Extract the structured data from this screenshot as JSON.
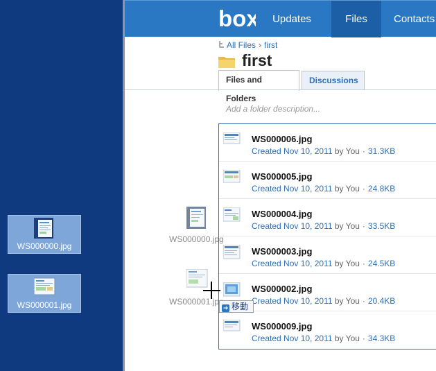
{
  "desktop": {
    "icons": [
      {
        "name": "WS000000.jpg"
      },
      {
        "name": "WS000001.jpg"
      }
    ]
  },
  "topbar": {
    "logo_text": "box",
    "nav": [
      {
        "label": "Updates"
      },
      {
        "label": "Files"
      },
      {
        "label": "Contacts"
      }
    ]
  },
  "breadcrumb": {
    "root": "All Files",
    "sep": "›",
    "current": "first"
  },
  "folder": {
    "title": "first",
    "description_placeholder": "Add a folder description..."
  },
  "tabs": [
    {
      "label": "Files and Folders"
    },
    {
      "label": "Discussions"
    }
  ],
  "files": [
    {
      "name": "WS000006.jpg",
      "created": "Created Nov 10, 2011",
      "by": "by You",
      "size": "31.3KB"
    },
    {
      "name": "WS000005.jpg",
      "created": "Created Nov 10, 2011",
      "by": "by You",
      "size": "24.8KB"
    },
    {
      "name": "WS000004.jpg",
      "created": "Created Nov 10, 2011",
      "by": "by You",
      "size": "33.5KB"
    },
    {
      "name": "WS000003.jpg",
      "created": "Created Nov 10, 2011",
      "by": "by You",
      "size": "24.5KB"
    },
    {
      "name": "WS000002.jpg",
      "created": "Created Nov 10, 2011",
      "by": "by You",
      "size": "20.4KB"
    },
    {
      "name": "WS000009.jpg",
      "created": "Created Nov 10, 2011",
      "by": "by You",
      "size": "34.3KB"
    }
  ],
  "drag": {
    "ghost_names": [
      "WS000000.jpg",
      "WS000001.jpg"
    ],
    "tooltip": "移動"
  },
  "colors": {
    "desktop_bg": "#0f3a80",
    "topbar_bg": "#2a78c4",
    "active_nav_bg": "#1c5fa6",
    "link": "#2d6fb8"
  }
}
